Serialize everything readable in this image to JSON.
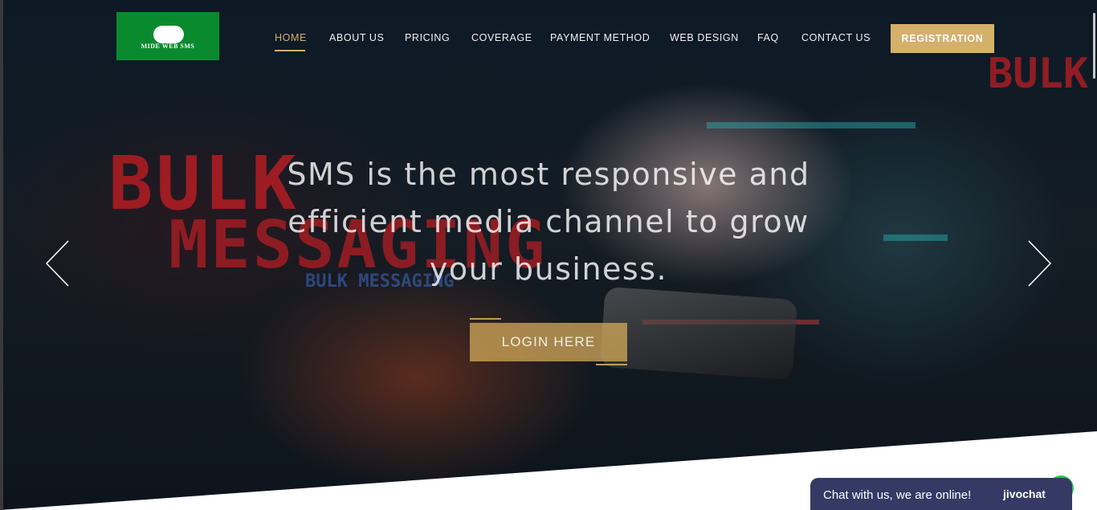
{
  "logo": {
    "text": "MIDE WEB SMS",
    "color": "#0a8a2e"
  },
  "nav": {
    "items": [
      {
        "label": "HOME",
        "active": true
      },
      {
        "label": "ABOUT US"
      },
      {
        "label": "PRICING"
      },
      {
        "label": "COVERAGE"
      },
      {
        "label": "PAYMENT METHOD"
      },
      {
        "label": "WEB DESIGN"
      },
      {
        "label": "FAQ"
      },
      {
        "label": "CONTACT US"
      }
    ],
    "registration_label": "REGISTRATION",
    "accent": "#d4b06a"
  },
  "hero": {
    "headline": "SMS is the most responsive and efficient media channel to grow your business.",
    "login_label": "LOGIN HERE",
    "background_words": {
      "bulk": "BULK",
      "messaging": "MESSAGING",
      "bulk_messaging_small": "BULK MESSAGING"
    },
    "prev_icon": "chevron-left-icon",
    "next_icon": "chevron-right-icon"
  },
  "chat": {
    "text": "Chat with us, we are online!",
    "brand": "jivochat",
    "color": "#343a63",
    "status_color": "#2ec44a"
  }
}
